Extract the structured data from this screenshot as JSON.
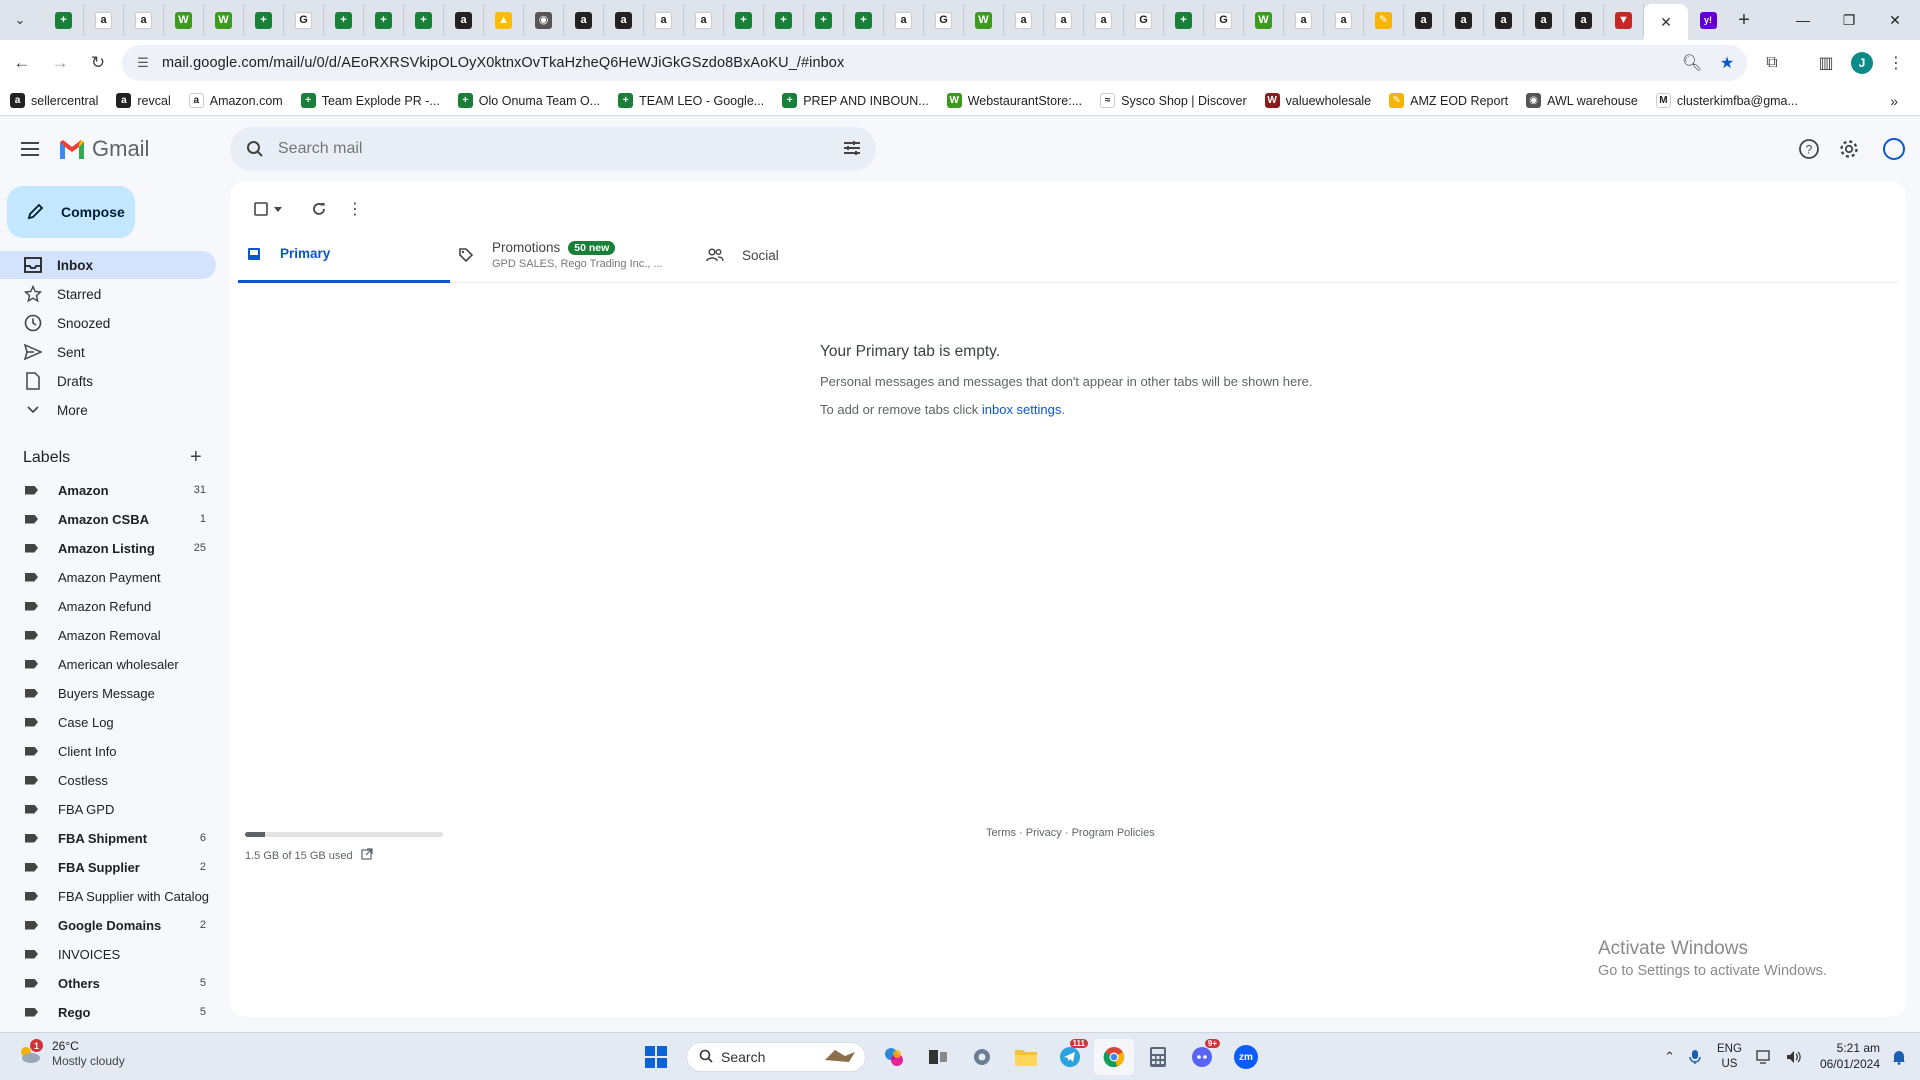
{
  "browser": {
    "tab_favicons": [
      {
        "icon": "sheets-icon",
        "color": "#188038",
        "glyph": "+"
      },
      {
        "icon": "amazon-icon",
        "color": "#ffffff",
        "glyph": "a"
      },
      {
        "icon": "amazon-icon",
        "color": "#ffffff",
        "glyph": "a"
      },
      {
        "icon": "webstaurant-icon",
        "color": "#3c9a1e",
        "glyph": "W"
      },
      {
        "icon": "webstaurant-icon",
        "color": "#3c9a1e",
        "glyph": "W"
      },
      {
        "icon": "sheets-icon",
        "color": "#188038",
        "glyph": "+"
      },
      {
        "icon": "google-icon",
        "color": "#ffffff",
        "glyph": "G"
      },
      {
        "icon": "sheets-icon",
        "color": "#188038",
        "glyph": "+"
      },
      {
        "icon": "sheets-icon",
        "color": "#188038",
        "glyph": "+"
      },
      {
        "icon": "sheets-icon",
        "color": "#188038",
        "glyph": "+"
      },
      {
        "icon": "amazon-dark-icon",
        "color": "#222222",
        "glyph": "a"
      },
      {
        "icon": "drive-icon",
        "color": "#fbbc04",
        "glyph": "▲"
      },
      {
        "icon": "globe-icon",
        "color": "#555555",
        "glyph": "◉"
      },
      {
        "icon": "amazon-dark-icon",
        "color": "#222222",
        "glyph": "a"
      },
      {
        "icon": "amazon-dark-icon",
        "color": "#222222",
        "glyph": "a"
      },
      {
        "icon": "amazon-icon",
        "color": "#ffffff",
        "glyph": "a"
      },
      {
        "icon": "amazon-icon",
        "color": "#ffffff",
        "glyph": "a"
      },
      {
        "icon": "sheets-icon",
        "color": "#188038",
        "glyph": "+"
      },
      {
        "icon": "sheets-icon",
        "color": "#188038",
        "glyph": "+"
      },
      {
        "icon": "sheets-icon",
        "color": "#188038",
        "glyph": "+"
      },
      {
        "icon": "sheets-icon",
        "color": "#188038",
        "glyph": "+"
      },
      {
        "icon": "amazon-icon",
        "color": "#ffffff",
        "glyph": "a"
      },
      {
        "icon": "google-icon",
        "color": "#ffffff",
        "glyph": "G"
      },
      {
        "icon": "webstaurant-icon",
        "color": "#3c9a1e",
        "glyph": "W"
      },
      {
        "icon": "amazon-icon",
        "color": "#ffffff",
        "glyph": "a"
      },
      {
        "icon": "amazon-icon",
        "color": "#ffffff",
        "glyph": "a"
      },
      {
        "icon": "amazon-icon",
        "color": "#ffffff",
        "glyph": "a"
      },
      {
        "icon": "google-icon",
        "color": "#ffffff",
        "glyph": "G"
      },
      {
        "icon": "sheets-icon",
        "color": "#188038",
        "glyph": "+"
      },
      {
        "icon": "google-icon",
        "color": "#ffffff",
        "glyph": "G"
      },
      {
        "icon": "webstaurant-icon",
        "color": "#3c9a1e",
        "glyph": "W"
      },
      {
        "icon": "amazon-icon",
        "color": "#ffffff",
        "glyph": "a"
      },
      {
        "icon": "amazon-icon",
        "color": "#ffffff",
        "glyph": "a"
      },
      {
        "icon": "amz-eod-icon",
        "color": "#f4b400",
        "glyph": "✎"
      },
      {
        "icon": "amazon-dark-icon",
        "color": "#222222",
        "glyph": "a"
      },
      {
        "icon": "amazon-dark-icon",
        "color": "#222222",
        "glyph": "a"
      },
      {
        "icon": "amazon-dark-icon",
        "color": "#222222",
        "glyph": "a"
      },
      {
        "icon": "amazon-dark-icon",
        "color": "#222222",
        "glyph": "a"
      },
      {
        "icon": "amazon-dark-icon",
        "color": "#222222",
        "glyph": "a"
      },
      {
        "icon": "red-triangle-icon",
        "color": "#c62828",
        "glyph": "▼"
      }
    ],
    "active_tab_close": "✕",
    "yahoo_tab_glyph": "y!",
    "url": "mail.google.com/mail/u/0/d/AEoRXRSVkipOLOyX0ktnxOvTkaHzheQ6HeWJiGkGSzdo8BxAoKU_/#inbox",
    "profile_initial": "J",
    "bookmarks": [
      {
        "label": "sellercentral",
        "icon": "amazon-dark-icon",
        "color": "#222222",
        "glyph": "a"
      },
      {
        "label": "revcal",
        "icon": "amazon-dark-icon",
        "color": "#222222",
        "glyph": "a"
      },
      {
        "label": "Amazon.com",
        "icon": "amazon-icon",
        "color": "#ffffff",
        "glyph": "a"
      },
      {
        "label": "Team Explode PR -...",
        "icon": "sheets-icon",
        "color": "#188038",
        "glyph": "+"
      },
      {
        "label": "Olo Onuma Team O...",
        "icon": "sheets-icon",
        "color": "#188038",
        "glyph": "+"
      },
      {
        "label": "TEAM LEO - Google...",
        "icon": "sheets-icon",
        "color": "#188038",
        "glyph": "+"
      },
      {
        "label": "PREP AND INBOUN...",
        "icon": "sheets-icon",
        "color": "#188038",
        "glyph": "+"
      },
      {
        "label": "WebstaurantStore:...",
        "icon": "webstaurant-icon",
        "color": "#3c9a1e",
        "glyph": "W"
      },
      {
        "label": "Sysco Shop | Discover",
        "icon": "sysco-icon",
        "color": "#ffffff",
        "glyph": "≈"
      },
      {
        "label": "valuewholesale",
        "icon": "vw-icon",
        "color": "#8b1a1a",
        "glyph": "W"
      },
      {
        "label": "AMZ EOD Report",
        "icon": "amz-eod-icon",
        "color": "#f4b400",
        "glyph": "✎"
      },
      {
        "label": "AWL warehouse",
        "icon": "globe-icon",
        "color": "#555555",
        "glyph": "◉"
      },
      {
        "label": "clusterkimfba@gma...",
        "icon": "gmail-icon",
        "color": "#ffffff",
        "glyph": "M"
      }
    ]
  },
  "gmail": {
    "brand": "Gmail",
    "search_placeholder": "Search mail",
    "compose_label": "Compose",
    "nav": [
      {
        "label": "Inbox",
        "icon": "inbox-icon",
        "active": true
      },
      {
        "label": "Starred",
        "icon": "star-icon",
        "active": false
      },
      {
        "label": "Snoozed",
        "icon": "clock-icon",
        "active": false
      },
      {
        "label": "Sent",
        "icon": "send-icon",
        "active": false
      },
      {
        "label": "Drafts",
        "icon": "draft-icon",
        "active": false
      },
      {
        "label": "More",
        "icon": "chevron-down-icon",
        "active": false
      }
    ],
    "labels_heading": "Labels",
    "labels": [
      {
        "name": "Amazon",
        "count": "31",
        "bold": true
      },
      {
        "name": "Amazon CSBA",
        "count": "1",
        "bold": true
      },
      {
        "name": "Amazon Listing",
        "count": "25",
        "bold": true
      },
      {
        "name": "Amazon Payment",
        "count": "",
        "bold": false
      },
      {
        "name": "Amazon Refund",
        "count": "",
        "bold": false
      },
      {
        "name": "Amazon Removal",
        "count": "",
        "bold": false
      },
      {
        "name": "American wholesaler",
        "count": "",
        "bold": false
      },
      {
        "name": "Buyers Message",
        "count": "",
        "bold": false
      },
      {
        "name": "Case Log",
        "count": "",
        "bold": false
      },
      {
        "name": "Client Info",
        "count": "",
        "bold": false
      },
      {
        "name": "Costless",
        "count": "",
        "bold": false
      },
      {
        "name": "FBA GPD",
        "count": "",
        "bold": false
      },
      {
        "name": "FBA Shipment",
        "count": "6",
        "bold": true
      },
      {
        "name": "FBA Supplier",
        "count": "2",
        "bold": true
      },
      {
        "name": "FBA Supplier with Catalog",
        "count": "",
        "bold": false
      },
      {
        "name": "Google Domains",
        "count": "2",
        "bold": true
      },
      {
        "name": "INVOICES",
        "count": "",
        "bold": false
      },
      {
        "name": "Others",
        "count": "5",
        "bold": true
      },
      {
        "name": "Rego",
        "count": "5",
        "bold": true
      }
    ],
    "tabs": {
      "primary": "Primary",
      "promotions": "Promotions",
      "promotions_badge": "50 new",
      "promotions_sub": "GPD SALES, Rego Trading Inc., ...",
      "social": "Social"
    },
    "empty": {
      "title": "Your Primary tab is empty.",
      "line1": "Personal messages and messages that don't appear in other tabs will be shown here.",
      "line2_prefix": "To add or remove tabs click ",
      "line2_link": "inbox settings",
      "line2_suffix": "."
    },
    "storage": {
      "text": "1.5 GB of 15 GB used",
      "fraction_used": 0.1
    },
    "footer": {
      "terms": "Terms",
      "privacy": "Privacy",
      "policies": "Program Policies",
      "sep": " · "
    }
  },
  "watermark": {
    "line1": "Activate Windows",
    "line2": "Go to Settings to activate Windows."
  },
  "taskbar": {
    "weather_badge": "1",
    "temp": "26°C",
    "condition": "Mostly cloudy",
    "search_label": "Search",
    "telegram_badge": "111",
    "discord_badge": "9+",
    "zoom_label": "zm",
    "lang_top": "ENG",
    "lang_bottom": "US",
    "time": "5:21 am",
    "date": "06/01/2024"
  }
}
